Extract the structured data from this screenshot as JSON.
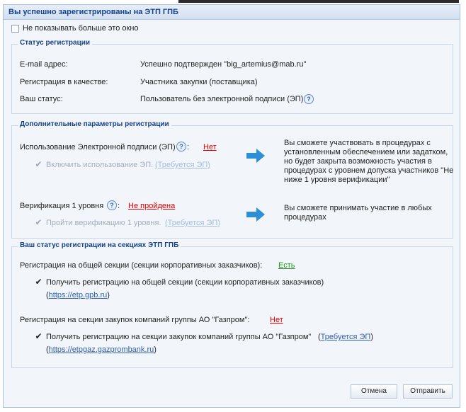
{
  "dialog": {
    "title": "Вы успешно зарегистрированы на ЭТП ГПБ",
    "dont_show_label": "Не показывать больше это окно"
  },
  "status": {
    "legend": "Статус регистрации",
    "email_label": "E-mail адрес:",
    "email_value": "Успешно подтвержден \"big_artemius@mab.ru\"",
    "role_label": "Регистрация в качестве:",
    "role_value": "Участника закупки (поставщика)",
    "status_label": "Ваш статус:",
    "status_value": "Пользователь без электронной подписи (ЭП)"
  },
  "params": {
    "legend": "Дополнительные параметры регистрации",
    "ep_label": "Использование Электронной подписи (ЭП)",
    "ep_value": "Нет",
    "ep_enable_text": "Включить использование ЭП.",
    "ep_requires_link": "(Требуется ЭП)",
    "ep_info": "Вы сможете участвовать в процедурах с установленным обеспечением или задатком, но будет закрыта возможность участия в процедурах с уровнем допуска участников \"Не ниже 1 уровня верификации\"",
    "verif_label": "Верификация 1 уровня",
    "verif_colon": ":",
    "verif_value": "Не пройдена",
    "verif_pass_text": "Пройти верификацию 1 уровня.",
    "verif_requires_link": "(Требуется ЭП)",
    "verif_info": "Вы сможете принимать участие в любых процедурах"
  },
  "sections": {
    "legend": "Ваш статус регистрации на секциях ЭТП ГПБ",
    "general_label": "Регистрация на общей секции (секции корпоративных заказчиков):",
    "general_value": "Есть",
    "general_cb_text": "Получить регистрацию на общей секции (секции корпоративных заказчиков)",
    "general_link": "https://etp.gpb.ru",
    "gazprom_label": "Регистрация на секции закупок компаний группы  АО \"Газпром\":",
    "gazprom_value": "Нет",
    "gazprom_cb_text": "Получить регистрацию на секции закупок компаний группы  АО \"Газпром\"",
    "gazprom_requires_link": "Требуется ЭП",
    "gazprom_link": "https://etpgaz.gazprombank.ru"
  },
  "buttons": {
    "cancel": "Отмена",
    "submit": "Отправить"
  },
  "colors": {
    "title": "#15428b",
    "negative": "#e00000",
    "positive": "#1c9c1c",
    "arrow": "#2d8fd8"
  },
  "icons": {
    "help": "question-mark-circle",
    "arrow": "right-arrow",
    "check": "checkmark"
  }
}
